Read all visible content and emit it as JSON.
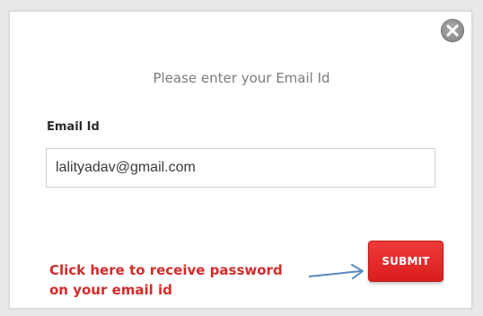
{
  "dialog": {
    "title": "Please enter your Email Id",
    "close_icon": "close-circle-icon",
    "email_label": "Email Id",
    "email_value": "lalityadav@gmail.com",
    "submit_label": "SUBMIT"
  },
  "annotation": {
    "line1": "Click here to receive password",
    "line2": "on your email id",
    "arrow_icon": "arrow-right-icon"
  },
  "colors": {
    "submit_red": "#e22828",
    "annotation_red": "#d62b2b",
    "arrow_blue": "#5a86bf"
  }
}
